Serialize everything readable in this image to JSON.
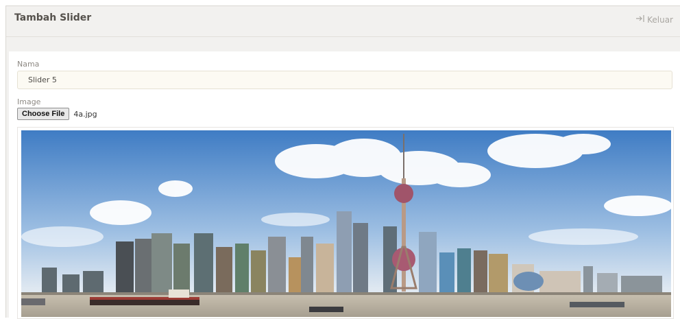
{
  "header": {
    "title": "Tambah Slider",
    "logout_label": "Keluar"
  },
  "form": {
    "nama_label": "Nama",
    "nama_value": "Slider 5",
    "image_label": "Image",
    "choose_file_label": "Choose File",
    "file_name": "4a.jpg"
  },
  "preview": {
    "description_icon": "city-skyline-photo"
  },
  "colors": {
    "sky_top": "#4c86c9",
    "sky_bottom": "#dfe9f4",
    "water": "#bfb7a7"
  }
}
